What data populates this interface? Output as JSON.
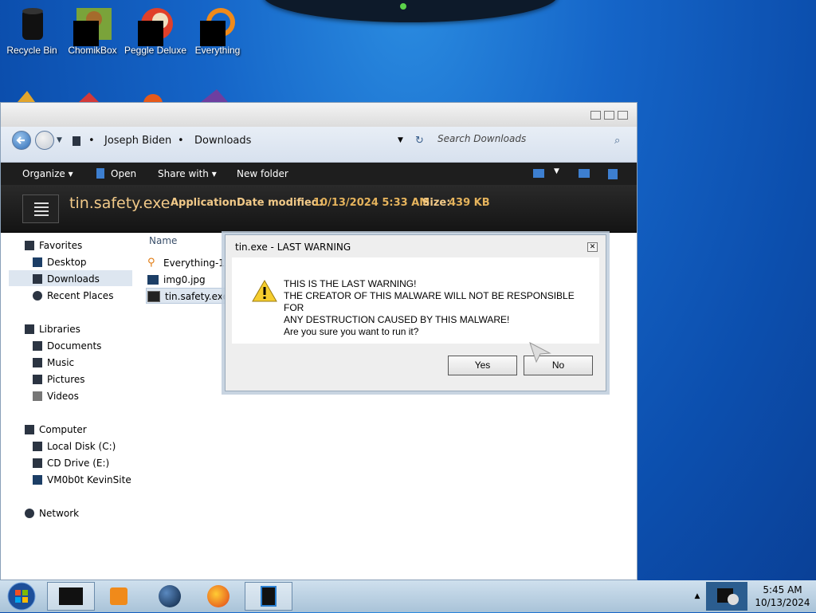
{
  "desktop": {
    "icons": [
      {
        "label": "Recycle Bin",
        "icon": "recycle-bin-icon"
      },
      {
        "label": "ChomikBox",
        "icon": "chomikbox-icon"
      },
      {
        "label": "Peggle Deluxe",
        "icon": "peggle-icon"
      },
      {
        "label": "Everything",
        "icon": "everything-search-icon"
      }
    ]
  },
  "explorer": {
    "breadcrumb": [
      "Joseph Biden",
      "Downloads"
    ],
    "search_placeholder": "Search Downloads",
    "toolbar": {
      "organize": "Organize",
      "open": "Open",
      "share_with": "Share with",
      "new_folder": "New folder"
    },
    "details": {
      "filename": "tin.safety.exe",
      "type": "Application",
      "date_label": "Date modified:",
      "date_value": "10/13/2024 5:33 AM",
      "size_label": "Size:",
      "size_value": "439 KB"
    },
    "nav": {
      "favorites": "Favorites",
      "desktop": "Desktop",
      "downloads": "Downloads",
      "recent": "Recent Places",
      "libraries": "Libraries",
      "documents": "Documents",
      "music": "Music",
      "pictures": "Pictures",
      "videos": "Videos",
      "computer": "Computer",
      "local_disk": "Local Disk (C:)",
      "cd_drive": "CD Drive (E:)",
      "vm_drive": "VM0b0t KevinSite",
      "network": "Network"
    },
    "column_name": "Name",
    "files": [
      {
        "name": "Everything-1.4",
        "icon": "magnifier-icon"
      },
      {
        "name": "img0.jpg",
        "icon": "image-icon"
      },
      {
        "name": "tin.safety.exe",
        "icon": "app-icon"
      }
    ]
  },
  "dialog": {
    "title": "tin.exe - LAST WARNING",
    "lines": [
      "THIS IS THE LAST WARNING!",
      "THE CREATOR OF THIS MALWARE WILL NOT BE RESPONSIBLE FOR",
      "ANY DESTRUCTION CAUSED BY THIS MALWARE!",
      "Are you sure you want to run it?"
    ],
    "yes": "Yes",
    "no": "No"
  },
  "taskbar": {
    "time": "5:45 AM",
    "date": "10/13/2024"
  }
}
